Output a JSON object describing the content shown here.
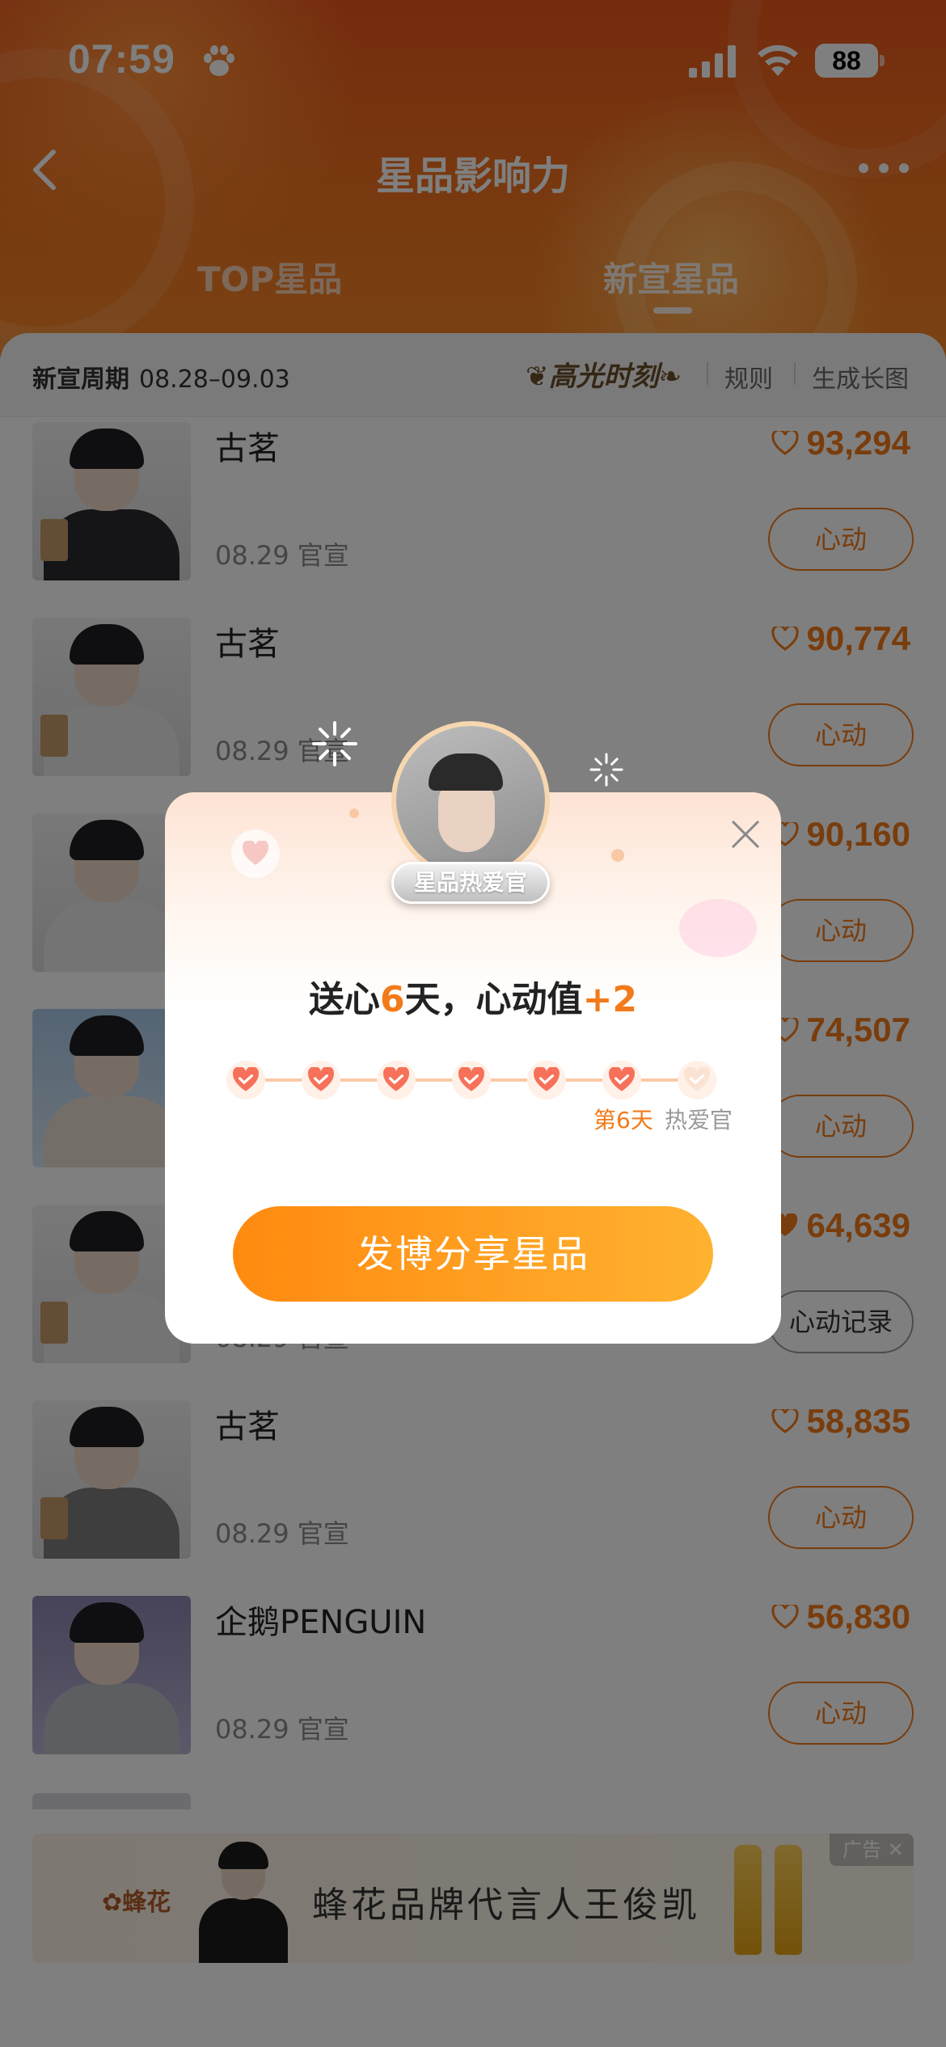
{
  "status": {
    "time": "07:59",
    "battery": "88"
  },
  "nav": {
    "title": "星品影响力"
  },
  "tabs": [
    {
      "label": "TOP星品"
    },
    {
      "label": "新宣星品"
    }
  ],
  "period": {
    "label": "新宣周期",
    "range": "08.28–09.03"
  },
  "links": {
    "highlight": "高光时刻",
    "rules": "规则",
    "long_image": "生成长图"
  },
  "rows": [
    {
      "brand": "古茗",
      "date": "08.29 官宣",
      "score": "93,294",
      "button": "心动"
    },
    {
      "brand": "古茗",
      "date": "08.29 官宣",
      "score": "90,774",
      "button": "心动"
    },
    {
      "brand": "",
      "date": "",
      "score": "90,160",
      "button": "心动"
    },
    {
      "brand": "",
      "date": "",
      "score": "74,507",
      "button": "心动"
    },
    {
      "brand": "",
      "date": "08.29 官宣",
      "score": "64,639",
      "button": "心动记录"
    },
    {
      "brand": "古茗",
      "date": "08.29 官宣",
      "score": "58,835",
      "button": "心动"
    },
    {
      "brand": "企鹅PENGUIN",
      "date": "08.29 官宣",
      "score": "56,830",
      "button": "心动"
    }
  ],
  "ad": {
    "logo": "蜂花",
    "text": "蜂花品牌代言人王俊凯",
    "badge": "广告"
  },
  "modal": {
    "badge": "星品热爱官",
    "msg_prefix": "送心",
    "msg_days": "6",
    "msg_mid": "天，心动值",
    "msg_plus": "+2",
    "day_label": "第6天",
    "fan_label": "热爱官",
    "share_button": "发博分享星品",
    "hearts_total": 7,
    "hearts_filled": 6
  },
  "colors": {
    "accent": "#f27a1a",
    "header": "#ee651e"
  },
  "icons": [
    "back-icon",
    "more-icon",
    "heart-icon",
    "close-icon",
    "paw-icon"
  ]
}
